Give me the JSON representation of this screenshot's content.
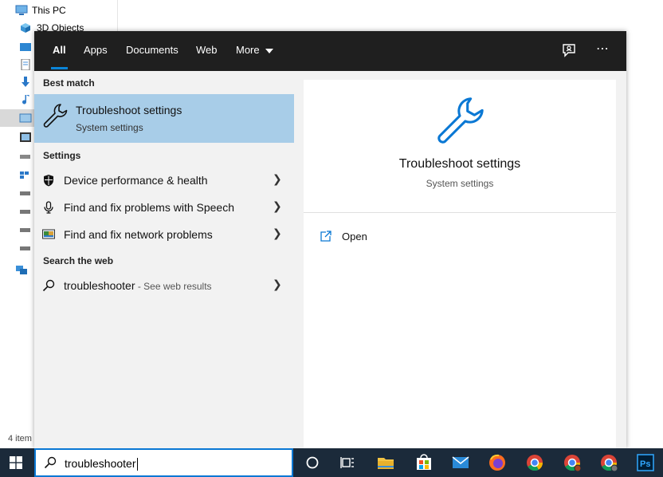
{
  "explorer": {
    "nav_items": [
      "This PC",
      "3D Objects"
    ],
    "status": "4 item"
  },
  "search_panel": {
    "tabs": [
      {
        "label": "All",
        "active": true
      },
      {
        "label": "Apps"
      },
      {
        "label": "Documents"
      },
      {
        "label": "Web"
      },
      {
        "label": "More"
      }
    ],
    "top_icons": [
      "feedback-icon",
      "more-options-icon"
    ],
    "best_match": {
      "heading": "Best match",
      "title": "Troubleshoot settings",
      "subtitle": "System settings",
      "icon": "wrench-icon"
    },
    "settings": {
      "heading": "Settings",
      "items": [
        {
          "label": "Device performance & health",
          "icon": "shield-icon"
        },
        {
          "label": "Find and fix problems with Speech",
          "icon": "microphone-icon"
        },
        {
          "label": "Find and fix network problems",
          "icon": "network-icon"
        }
      ]
    },
    "web": {
      "heading": "Search the web",
      "query": "troubleshooter",
      "suffix": " - See web results"
    },
    "preview": {
      "title": "Troubleshoot settings",
      "subtitle": "System settings",
      "action_label": "Open"
    }
  },
  "taskbar": {
    "search_value": "troubleshooter",
    "icons": [
      "windows-start-icon",
      "cortana-icon",
      "task-view-icon",
      "file-explorer-icon",
      "store-icon",
      "mail-icon",
      "firefox-icon",
      "chrome-icon",
      "chrome-profile-icon",
      "chrome-profile-2-icon",
      "photoshop-icon"
    ]
  },
  "colors": {
    "accent": "#0a84d8",
    "selection": "#a8cde8",
    "topbar": "#1f1f1f",
    "taskbar": "#1b2a3a"
  }
}
